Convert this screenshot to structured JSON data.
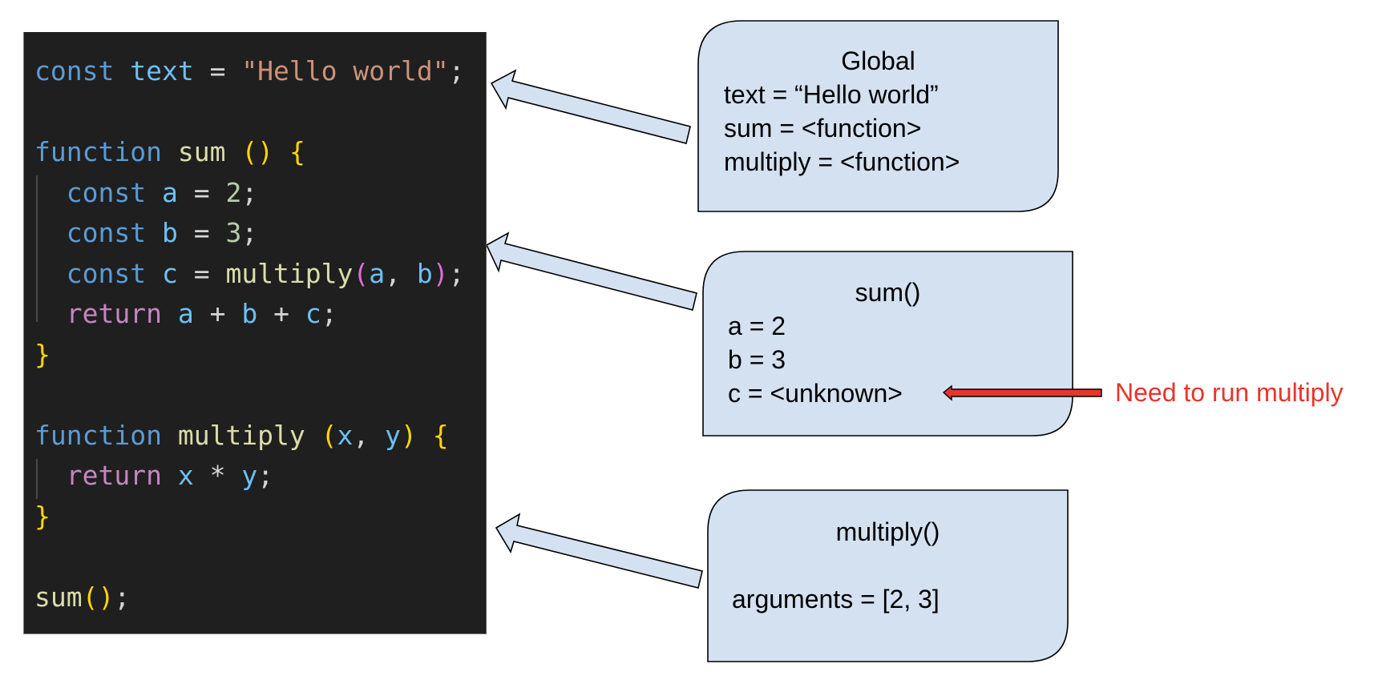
{
  "code": {
    "lines": [
      {
        "tokens": [
          {
            "t": "const",
            "c": "kw"
          },
          {
            "t": " "
          },
          {
            "t": "text",
            "c": "var"
          },
          {
            "t": " = ",
            "c": "op"
          },
          {
            "t": "\"Hello world\"",
            "c": "str"
          },
          {
            "t": ";",
            "c": "punc"
          }
        ]
      },
      {
        "tokens": []
      },
      {
        "tokens": [
          {
            "t": "function",
            "c": "kw"
          },
          {
            "t": " "
          },
          {
            "t": "sum",
            "c": "fn"
          },
          {
            "t": " "
          },
          {
            "t": "()",
            "c": "brace"
          },
          {
            "t": " "
          },
          {
            "t": "{",
            "c": "brace"
          }
        ]
      },
      {
        "tokens": [
          {
            "t": "  "
          },
          {
            "t": "const",
            "c": "kw"
          },
          {
            "t": " "
          },
          {
            "t": "a",
            "c": "var"
          },
          {
            "t": " = ",
            "c": "op"
          },
          {
            "t": "2",
            "c": "num"
          },
          {
            "t": ";",
            "c": "punc"
          }
        ]
      },
      {
        "tokens": [
          {
            "t": "  "
          },
          {
            "t": "const",
            "c": "kw"
          },
          {
            "t": " "
          },
          {
            "t": "b",
            "c": "var"
          },
          {
            "t": " = ",
            "c": "op"
          },
          {
            "t": "3",
            "c": "num"
          },
          {
            "t": ";",
            "c": "punc"
          }
        ]
      },
      {
        "tokens": [
          {
            "t": "  "
          },
          {
            "t": "const",
            "c": "kw"
          },
          {
            "t": " "
          },
          {
            "t": "c",
            "c": "var"
          },
          {
            "t": " = ",
            "c": "op"
          },
          {
            "t": "multiply",
            "c": "fn"
          },
          {
            "t": "(",
            "c": "paren2"
          },
          {
            "t": "a",
            "c": "var"
          },
          {
            "t": ", ",
            "c": "op"
          },
          {
            "t": "b",
            "c": "var"
          },
          {
            "t": ")",
            "c": "paren2"
          },
          {
            "t": ";",
            "c": "punc"
          }
        ]
      },
      {
        "tokens": [
          {
            "t": "  "
          },
          {
            "t": "return",
            "c": "ret"
          },
          {
            "t": " "
          },
          {
            "t": "a",
            "c": "var"
          },
          {
            "t": " + ",
            "c": "op"
          },
          {
            "t": "b",
            "c": "var"
          },
          {
            "t": " + ",
            "c": "op"
          },
          {
            "t": "c",
            "c": "var"
          },
          {
            "t": ";",
            "c": "punc"
          }
        ]
      },
      {
        "tokens": [
          {
            "t": "}",
            "c": "brace"
          }
        ]
      },
      {
        "tokens": []
      },
      {
        "tokens": [
          {
            "t": "function",
            "c": "kw"
          },
          {
            "t": " "
          },
          {
            "t": "multiply",
            "c": "fn"
          },
          {
            "t": " "
          },
          {
            "t": "(",
            "c": "brace"
          },
          {
            "t": "x",
            "c": "var"
          },
          {
            "t": ", ",
            "c": "op"
          },
          {
            "t": "y",
            "c": "var"
          },
          {
            "t": ")",
            "c": "brace"
          },
          {
            "t": " "
          },
          {
            "t": "{",
            "c": "brace"
          }
        ]
      },
      {
        "tokens": [
          {
            "t": "  "
          },
          {
            "t": "return",
            "c": "ret"
          },
          {
            "t": " "
          },
          {
            "t": "x",
            "c": "var"
          },
          {
            "t": " * ",
            "c": "op"
          },
          {
            "t": "y",
            "c": "var"
          },
          {
            "t": ";",
            "c": "punc"
          }
        ]
      },
      {
        "tokens": [
          {
            "t": "}",
            "c": "brace"
          }
        ]
      },
      {
        "tokens": []
      },
      {
        "tokens": [
          {
            "t": "sum",
            "c": "fn"
          },
          {
            "t": "()",
            "c": "brace"
          },
          {
            "t": ";",
            "c": "punc"
          }
        ]
      }
    ]
  },
  "frames": {
    "global": {
      "title": "Global",
      "lines": [
        "text = “Hello world”",
        "sum = <function>",
        "multiply = <function>"
      ]
    },
    "sum": {
      "title": "sum()",
      "lines": [
        "a = 2",
        "b = 3",
        "c = <unknown>"
      ]
    },
    "multiply": {
      "title": "multiply()",
      "lines": [
        "",
        "arguments = [2, 3]"
      ]
    }
  },
  "annotation": {
    "note": "Need to run multiply"
  },
  "colors": {
    "code_bg": "#1f1f1f",
    "frame_fill": "#d4e1f1",
    "frame_stroke": "#000000",
    "arrow_fill": "#d4e1f1",
    "note_red": "#e8352a"
  }
}
